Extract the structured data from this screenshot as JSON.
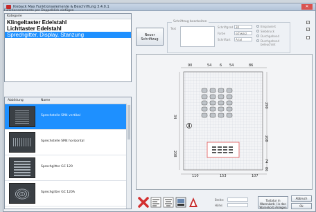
{
  "window": {
    "title": "Kieback Max Funktionselemente & Beschriftung 3.4.0.1",
    "close_label": "✕"
  },
  "left": {
    "section_label": "Funktionselemente per Doppelklick einfügen",
    "category_header": "Kategorie",
    "categories": [
      {
        "label": "Klingeltaster Edelstahl",
        "selected": false
      },
      {
        "label": "Lichttaster Edelstahl",
        "selected": false
      },
      {
        "label": "Sprechgitter, Display, Stanzung",
        "selected": true
      }
    ],
    "product_header_image": "Abbildung",
    "product_header_name": "Name",
    "products": [
      {
        "name": "Sprechstelle SM4 vertikal",
        "selected": true
      },
      {
        "name": "Sprechstelle SM4 horizontal",
        "selected": false
      },
      {
        "name": "Sprechgitter GC 120",
        "selected": false
      },
      {
        "name": "Sprechgitter GC 120A",
        "selected": false
      }
    ]
  },
  "new_button": {
    "line1": "Neuer",
    "line2": "Schriftzug"
  },
  "settings": {
    "legend": "Schriftzug bearbeiten",
    "text_label": "Text",
    "schriftgrad_label": "Schriftgrad",
    "schriftgrad_value": "30",
    "farbe_label": "Farbe",
    "farbe_value": "schwarz",
    "schriftart_label": "Schriftart",
    "schriftart_value": "Arial",
    "radio_options": [
      "Eingraviert",
      "Siebdruck",
      "Durchgehend",
      "Durchgehend beleuchtet"
    ]
  },
  "drawing": {
    "top_dims": [
      "90",
      "54",
      "6",
      "54",
      "86"
    ],
    "bottom_dims": [
      "110",
      "153",
      "107"
    ],
    "right_dims": [
      "290",
      "208",
      "74",
      "86"
    ],
    "left_dims": [
      "208",
      "34"
    ]
  },
  "bottom": {
    "breite_label": "Breite:",
    "hoehe_label": "Höhe:",
    "warenkorb_label": "Tastatur in Warenkorb / in den Warenkorb Anlegen",
    "abbruch_label": "Abbruch",
    "ok_label": "Ok"
  },
  "colors": {
    "accent": "#1e90ff",
    "delete": "#d32f2f",
    "pdf": "#c62828"
  }
}
